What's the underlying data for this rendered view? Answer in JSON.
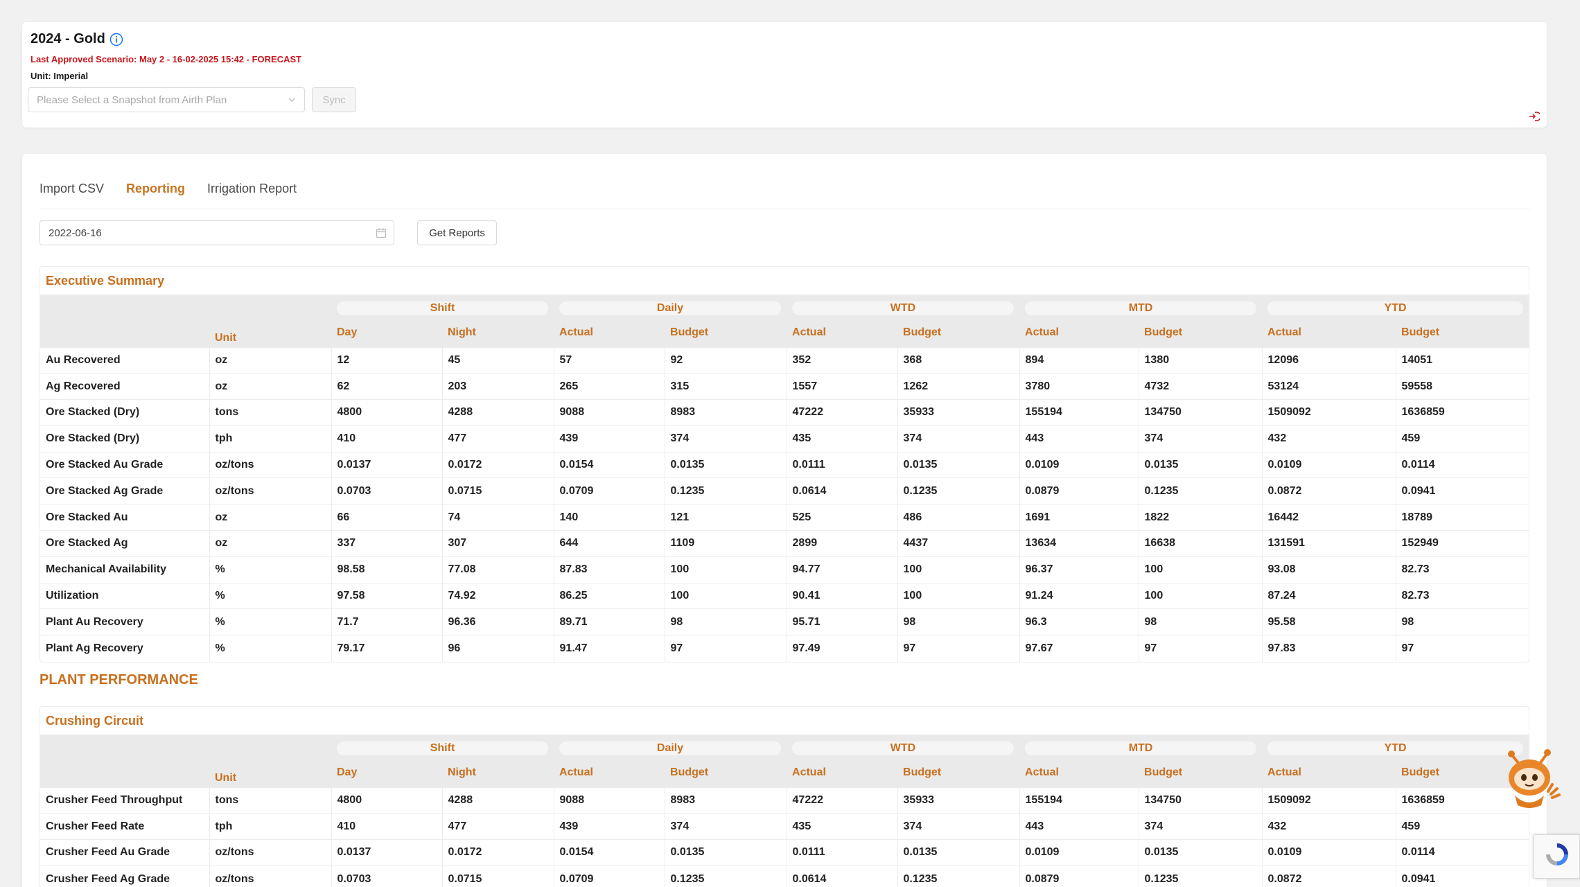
{
  "header": {
    "title": "2024 - Gold",
    "scenario": "Last Approved Scenario: May 2 - 16-02-2025 15:42 - FORECAST",
    "unit": "Unit: Imperial",
    "snapshot_placeholder": "Please Select a Snapshot from Airth Plan",
    "sync_label": "Sync"
  },
  "tabs": [
    "Import CSV",
    "Reporting",
    "Irrigation Report"
  ],
  "active_tab": "Reporting",
  "filter": {
    "date_value": "2022-06-16",
    "get_reports_label": "Get Reports"
  },
  "table_header": {
    "unit": "Unit",
    "groups": [
      "Shift",
      "Daily",
      "WTD",
      "MTD",
      "YTD"
    ],
    "subs": [
      "Day",
      "Night",
      "Actual",
      "Budget",
      "Actual",
      "Budget",
      "Actual",
      "Budget",
      "Actual",
      "Budget"
    ]
  },
  "executive_summary": {
    "title": "Executive Summary",
    "rows": [
      [
        "Au Recovered",
        "oz",
        "12",
        "45",
        "57",
        "92",
        "352",
        "368",
        "894",
        "1380",
        "12096",
        "14051"
      ],
      [
        "Ag Recovered",
        "oz",
        "62",
        "203",
        "265",
        "315",
        "1557",
        "1262",
        "3780",
        "4732",
        "53124",
        "59558"
      ],
      [
        "Ore Stacked (Dry)",
        "tons",
        "4800",
        "4288",
        "9088",
        "8983",
        "47222",
        "35933",
        "155194",
        "134750",
        "1509092",
        "1636859"
      ],
      [
        "Ore Stacked (Dry)",
        "tph",
        "410",
        "477",
        "439",
        "374",
        "435",
        "374",
        "443",
        "374",
        "432",
        "459"
      ],
      [
        "Ore Stacked Au Grade",
        "oz/tons",
        "0.0137",
        "0.0172",
        "0.0154",
        "0.0135",
        "0.0111",
        "0.0135",
        "0.0109",
        "0.0135",
        "0.0109",
        "0.0114"
      ],
      [
        "Ore Stacked Ag Grade",
        "oz/tons",
        "0.0703",
        "0.0715",
        "0.0709",
        "0.1235",
        "0.0614",
        "0.1235",
        "0.0879",
        "0.1235",
        "0.0872",
        "0.0941"
      ],
      [
        "Ore Stacked Au",
        "oz",
        "66",
        "74",
        "140",
        "121",
        "525",
        "486",
        "1691",
        "1822",
        "16442",
        "18789"
      ],
      [
        "Ore Stacked Ag",
        "oz",
        "337",
        "307",
        "644",
        "1109",
        "2899",
        "4437",
        "13634",
        "16638",
        "131591",
        "152949"
      ],
      [
        "Mechanical Availability",
        "%",
        "98.58",
        "77.08",
        "87.83",
        "100",
        "94.77",
        "100",
        "96.37",
        "100",
        "93.08",
        "82.73"
      ],
      [
        "Utilization",
        "%",
        "97.58",
        "74.92",
        "86.25",
        "100",
        "90.41",
        "100",
        "91.24",
        "100",
        "87.24",
        "82.73"
      ],
      [
        "Plant Au Recovery",
        "%",
        "71.7",
        "96.36",
        "89.71",
        "98",
        "95.71",
        "98",
        "96.3",
        "98",
        "95.58",
        "98"
      ],
      [
        "Plant Ag Recovery",
        "%",
        "79.17",
        "96",
        "91.47",
        "97",
        "97.49",
        "97",
        "97.67",
        "97",
        "97.83",
        "97"
      ]
    ]
  },
  "plant_performance_title": "PLANT PERFORMANCE",
  "crushing_circuit": {
    "title": "Crushing Circuit",
    "rows": [
      [
        "Crusher Feed Throughput",
        "tons",
        "4800",
        "4288",
        "9088",
        "8983",
        "47222",
        "35933",
        "155194",
        "134750",
        "1509092",
        "1636859"
      ],
      [
        "Crusher Feed Rate",
        "tph",
        "410",
        "477",
        "439",
        "374",
        "435",
        "374",
        "443",
        "374",
        "432",
        "459"
      ],
      [
        "Crusher Feed Au Grade",
        "oz/tons",
        "0.0137",
        "0.0172",
        "0.0154",
        "0.0135",
        "0.0111",
        "0.0135",
        "0.0109",
        "0.0135",
        "0.0109",
        "0.0114"
      ],
      [
        "Crusher Feed Ag Grade",
        "oz/tons",
        "0.0703",
        "0.0715",
        "0.0709",
        "0.1235",
        "0.0614",
        "0.1235",
        "0.0879",
        "0.1235",
        "0.0872",
        "0.0941"
      ]
    ]
  },
  "colors": {
    "accent": "#c8701e",
    "alert": "#c8161d",
    "info": "#1677ff"
  }
}
